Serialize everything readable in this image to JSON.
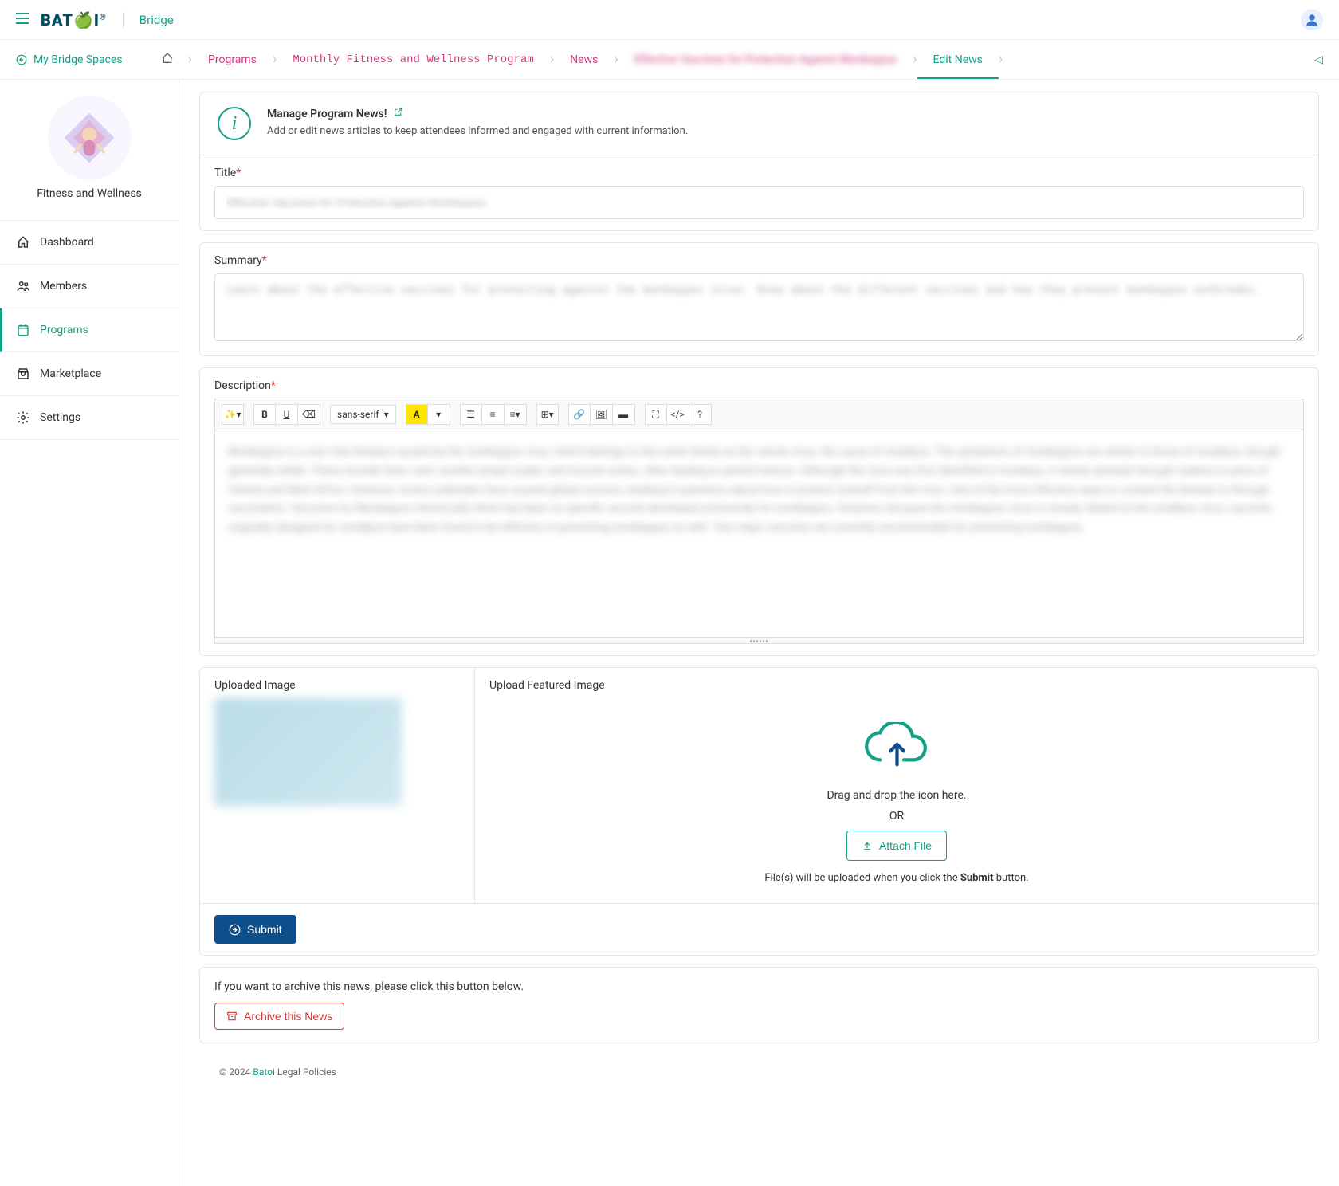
{
  "topbar": {
    "logo": "BAT I",
    "bridge": "Bridge"
  },
  "breadcrumb": {
    "home": "My Bridge Spaces",
    "items": [
      "Programs",
      "Monthly Fitness and Wellness Program",
      "News",
      "Effective Vaccines for Protection Against Monkeypox",
      "Edit News"
    ]
  },
  "sidebar": {
    "space_name": "Fitness and Wellness",
    "items": [
      {
        "label": "Dashboard"
      },
      {
        "label": "Members"
      },
      {
        "label": "Programs"
      },
      {
        "label": "Marketplace"
      },
      {
        "label": "Settings"
      }
    ]
  },
  "info": {
    "title": "Manage Program News!",
    "subtitle": "Add or edit news articles to keep attendees informed and engaged with current information."
  },
  "form": {
    "title_label": "Title",
    "title_value": "Effective Vaccines for Protection Against Monkeypox",
    "summary_label": "Summary",
    "summary_value": "Learn about the effective vaccines for protecting against the monkeypox virus. Know about the different vaccines and how they prevent monkeypox outbreaks.",
    "description_label": "Description",
    "description_value": "Monkeypox is a rare viral disease caused by the monkeypox virus, which belongs to the same family as the variola virus, the cause of smallpox. The symptoms of monkeypox are similar to those of smallpox, though generally milder. These include fever, rash, swollen lymph nodes, and muscle aches, often leading to painful lesions. Although the virus was first identified in monkeys, it mainly spreads through rodents in parts of Central and West Africa. However, recent outbreaks have caused global concern, leading to questions about how to protect oneself from the virus. One of the most effective ways to combat the disease is through vaccination.\n\nVaccines for Monkeypox Historically, there has been no specific vaccine developed exclusively for monkeypox. However, because the monkeypox virus is closely related to the smallpox virus, vaccines originally designed for smallpox have been found to be effective in preventing monkeypox as well. Two major vaccines are currently recommended for preventing monkeypox.",
    "font": "sans-serif"
  },
  "upload": {
    "uploaded_label": "Uploaded Image",
    "featured_label": "Upload Featured Image",
    "dragdrop": "Drag and drop the icon here.",
    "or": "OR",
    "attach": "Attach File",
    "note_pre": "File(s) will be uploaded when you click the ",
    "note_bold": "Submit",
    "note_post": " button."
  },
  "submit": {
    "label": "Submit"
  },
  "archive": {
    "text": "If you want to archive this news, please click this button below.",
    "button": "Archive this News"
  },
  "footer": {
    "copyright": "© 2024 ",
    "link": "Batoi",
    "policies": " Legal Policies"
  }
}
